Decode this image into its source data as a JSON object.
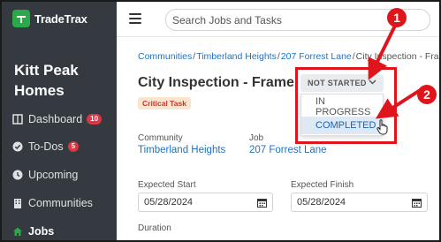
{
  "app": {
    "name": "TradeTrax",
    "org_name": "Kitt Peak Homes"
  },
  "sidebar": {
    "items": [
      {
        "label": "Dashboard",
        "icon": "dashboard-icon",
        "badge": "10"
      },
      {
        "label": "To-Dos",
        "icon": "check-circle-icon",
        "badge": "5"
      },
      {
        "label": "Upcoming",
        "icon": "clock-icon",
        "badge": ""
      },
      {
        "label": "Communities",
        "icon": "building-icon",
        "badge": ""
      },
      {
        "label": "Jobs",
        "icon": "home-icon",
        "badge": "",
        "active": true
      }
    ]
  },
  "topbar": {
    "search_placeholder": "Search Jobs and Tasks"
  },
  "breadcrumb": {
    "communities": "Communities",
    "community": "Timberland Heights",
    "job": "207 Forrest Lane",
    "current": "City Inspection - Frame",
    "sep": "/"
  },
  "task": {
    "title": "City Inspection - Frame",
    "badge": "Critical Task"
  },
  "status": {
    "current": "NOT STARTED",
    "options": [
      "IN PROGRESS",
      "COMPLETED"
    ]
  },
  "fields": {
    "community_label": "Community",
    "community_value": "Timberland Heights",
    "job_label": "Job",
    "job_value": "207 Forrest Lane",
    "expected_start_label": "Expected Start",
    "expected_start_value": "05/28/2024",
    "expected_finish_label": "Expected Finish",
    "expected_finish_value": "05/28/2024",
    "duration_label": "Duration"
  },
  "annotations": {
    "step1": "1",
    "step2": "2",
    "color": "#e0151b"
  },
  "colors": {
    "sidebar_bg": "#343a40",
    "brand_green": "#2ba84a",
    "link_blue": "#1a73c8",
    "badge_red": "#dc3545"
  }
}
